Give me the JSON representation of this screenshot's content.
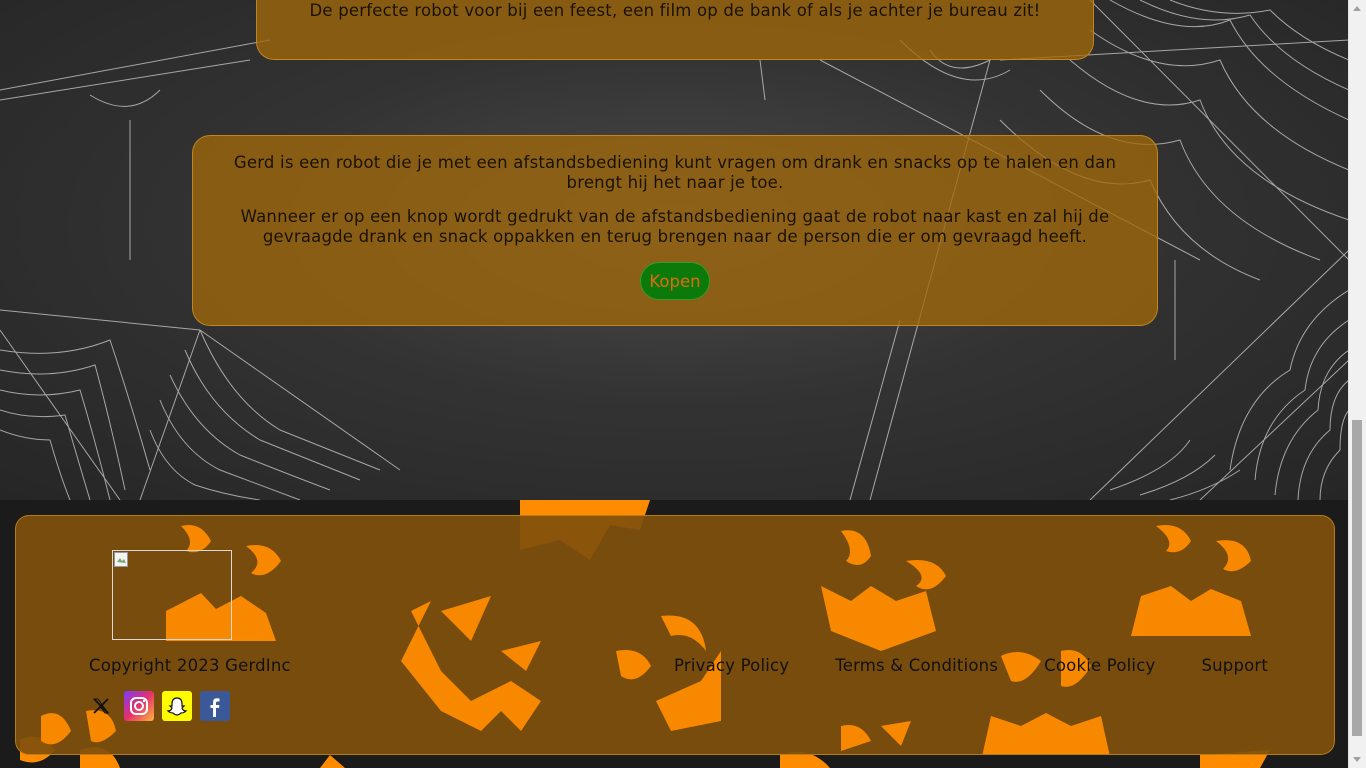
{
  "hero": {
    "tagline": "De perfecte robot voor bij een feest, een film op de bank of als je achter je bureau zit!",
    "description_1": "Gerd is een robot die je met een afstandsbediening kunt vragen om drank en snacks op te halen en dan brengt hij het naar je toe.",
    "description_2": "Wanneer er op een knop wordt gedrukt van de afstandsbediening gaat de robot naar kast en zal hij de gevraagde drank en snack oppakken en terug brengen naar de person die er om gevraagd heeft.",
    "buy_label": "Kopen"
  },
  "footer": {
    "copyright": "Copyright 2023 GerdInc",
    "links": [
      "Privacy Policy",
      "Terms & Conditions",
      "Cookie Policy",
      "Support"
    ],
    "socials": [
      "x-icon",
      "instagram-icon",
      "snapchat-icon",
      "facebook-icon"
    ]
  },
  "colors": {
    "card": "#a0690a",
    "footer_card": "#80500c",
    "buy_button": "#0b7a0b",
    "buy_text": "#e06a10",
    "pumpkin": "#ff8c00"
  }
}
